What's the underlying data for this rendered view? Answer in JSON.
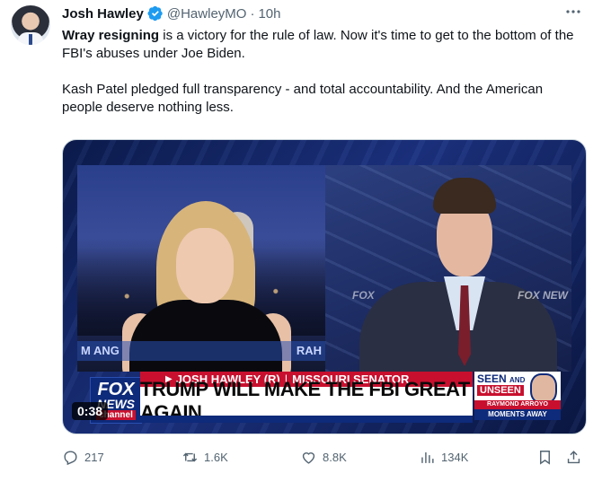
{
  "author": {
    "name": "Josh Hawley",
    "handle": "@HawleyMO",
    "separator": "·",
    "time": "10h",
    "verified_color": "#1d9bf0"
  },
  "tweet": {
    "bold_lead": "Wray resigning",
    "para1_rest": " is a victory for the rule of law. Now it's time to get to the bottom of the FBI's abuses under Joe Biden.",
    "para2": "Kash Patel pledged full transparency - and total accountability. And the American people deserve nothing less."
  },
  "video": {
    "duration": "0:38",
    "left_strip_left": "M ANG",
    "left_strip_right": "RAH",
    "watermark_left": "FOX",
    "watermark_right": "FOX NEW",
    "fox_logo": {
      "line1": "FOX",
      "line2": "NEWS",
      "line3": "channel"
    },
    "name_bar": {
      "name": "JOSH HAWLEY (R)",
      "sep": "|",
      "title": "MISSOURI SENATOR"
    },
    "headline": "TRUMP WILL MAKE THE FBI GREAT AGAIN",
    "promo": {
      "seen": "SEEN",
      "and": "AND",
      "unseen": "UNSEEN",
      "host": "RAYMOND ARROYO",
      "moments": "MOMENTS AWAY"
    },
    "colors": {
      "fox_blue": "#0e2a7a",
      "fox_red": "#c8102e"
    }
  },
  "actions": {
    "replies": "217",
    "reposts": "1.6K",
    "likes": "8.8K",
    "views": "134K"
  }
}
